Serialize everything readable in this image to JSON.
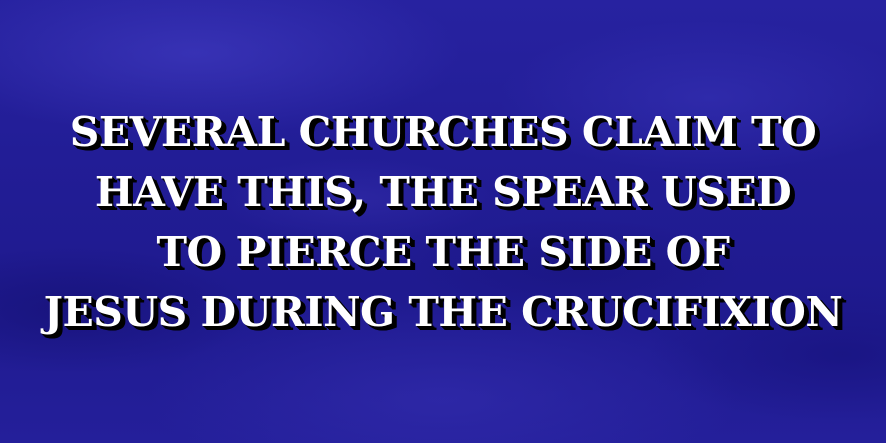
{
  "clue": {
    "lines": [
      "SEVERAL CHURCHES CLAIM TO",
      "HAVE THIS, THE SPEAR USED",
      "TO PIERCE THE SIDE OF",
      "JESUS DURING THE CRUCIFIXION"
    ]
  },
  "colors": {
    "background": "#221d96",
    "text": "#ffffff",
    "text_shadow": "#000000"
  }
}
